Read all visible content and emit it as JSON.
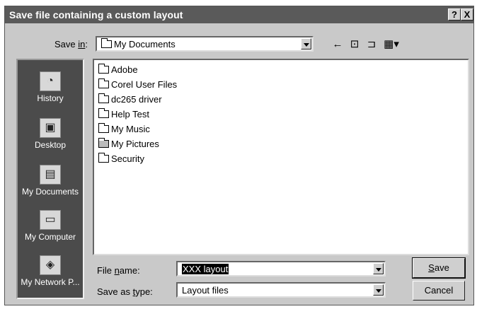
{
  "dialog": {
    "title": "Save file containing a custom layout",
    "help_button": "?",
    "close_button": "X"
  },
  "save_in": {
    "label_prefix": "Save ",
    "label_underline": "in",
    "label_suffix": ":",
    "value": "My Documents",
    "icon": "folder-icon"
  },
  "toolbar": {
    "back_icon": "back-arrow-icon",
    "up_icon": "up-one-level-icon",
    "new_folder_icon": "new-folder-icon",
    "views_icon": "views-menu-icon"
  },
  "places": [
    {
      "label": "History",
      "icon": "history-icon"
    },
    {
      "label": "Desktop",
      "icon": "desktop-icon"
    },
    {
      "label": "My Documents",
      "icon": "my-documents-icon"
    },
    {
      "label": "My Computer",
      "icon": "my-computer-icon"
    },
    {
      "label": "My Network P...",
      "icon": "my-network-places-icon"
    }
  ],
  "files": [
    {
      "name": "Adobe",
      "icon": "folder-icon"
    },
    {
      "name": "Corel User Files",
      "icon": "folder-icon"
    },
    {
      "name": "dc265 driver",
      "icon": "folder-icon"
    },
    {
      "name": "Help Test",
      "icon": "folder-icon"
    },
    {
      "name": "My Music",
      "icon": "folder-icon"
    },
    {
      "name": "My Pictures",
      "icon": "pictures-folder-icon"
    },
    {
      "name": "Security",
      "icon": "folder-icon"
    }
  ],
  "file_name": {
    "label_prefix": "File ",
    "label_underline": "n",
    "label_suffix": "ame:",
    "value": "XXX layout"
  },
  "save_as_type": {
    "label_prefix": "Save as ",
    "label_underline": "t",
    "label_suffix": "ype:",
    "value": "Layout files"
  },
  "buttons": {
    "save_underline": "S",
    "save_rest": "ave",
    "cancel": "Cancel"
  }
}
